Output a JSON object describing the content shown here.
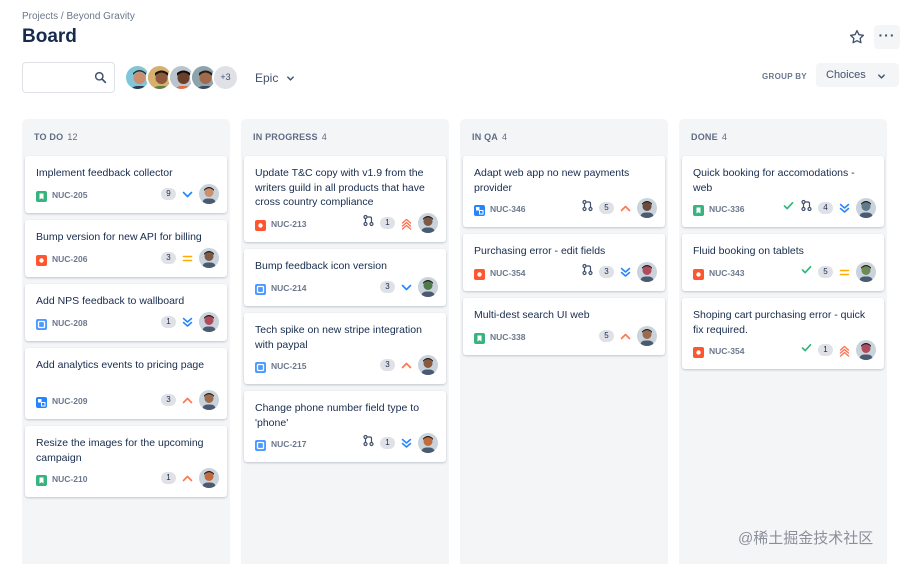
{
  "header": {
    "breadcrumb": "Projects / Beyond Gravity",
    "title": "Board"
  },
  "toolbar": {
    "search_placeholder": "",
    "avatar_more": "+3",
    "epic_label": "Epic",
    "group_by_label": "GROUP BY",
    "group_by_value": "Choices"
  },
  "columns": [
    {
      "name": "TO DO",
      "count": "12",
      "cards": [
        {
          "title": "Implement feedback collector",
          "key": "NUC-205",
          "type": "story",
          "estimate": "9",
          "priority": "low"
        },
        {
          "title": "Bump version for new API for billing",
          "key": "NUC-206",
          "type": "bug",
          "estimate": "3",
          "priority": "medium"
        },
        {
          "title": "Add NPS feedback to wallboard",
          "key": "NUC-208",
          "type": "task",
          "estimate": "1",
          "priority": "lowest"
        },
        {
          "title": "Add analytics events to pricing page",
          "key": "NUC-209",
          "type": "subtask",
          "estimate": "3",
          "priority": "high"
        },
        {
          "title": "Resize the images for the upcoming campaign",
          "key": "NUC-210",
          "type": "story",
          "estimate": "1",
          "priority": "high"
        }
      ]
    },
    {
      "name": "IN PROGRESS",
      "count": "4",
      "cards": [
        {
          "title": "Update T&C copy with v1.9 from the writers guild in all products that have cross country compliance",
          "key": "NUC-213",
          "type": "bug",
          "estimate": "1",
          "priority": "highest",
          "pr": true
        },
        {
          "title": "Bump feedback icon version",
          "key": "NUC-214",
          "type": "task",
          "estimate": "3",
          "priority": "low"
        },
        {
          "title": "Tech spike on new stripe integration with paypal",
          "key": "NUC-215",
          "type": "task",
          "estimate": "3",
          "priority": "high"
        },
        {
          "title": "Change phone number field type to 'phone'",
          "key": "NUC-217",
          "type": "task",
          "estimate": "1",
          "priority": "lowest",
          "pr": true
        }
      ]
    },
    {
      "name": "IN QA",
      "count": "4",
      "cards": [
        {
          "title": "Adapt web app no new payments provider",
          "key": "NUC-346",
          "type": "subtask",
          "estimate": "5",
          "priority": "high",
          "pr": true
        },
        {
          "title": "Purchasing error - edit fields",
          "key": "NUC-354",
          "type": "bug",
          "estimate": "3",
          "priority": "lowest",
          "pr": true
        },
        {
          "title": "Multi-dest search UI web",
          "key": "NUC-338",
          "type": "story",
          "estimate": "5",
          "priority": "high"
        }
      ]
    },
    {
      "name": "DONE",
      "count": "4",
      "cards": [
        {
          "title": "Quick booking for accomodations - web",
          "key": "NUC-336",
          "type": "story",
          "estimate": "4",
          "priority": "lowest",
          "pr": true,
          "done": true
        },
        {
          "title": "Fluid booking on tablets",
          "key": "NUC-343",
          "type": "bug",
          "estimate": "5",
          "priority": "medium",
          "done": true
        },
        {
          "title": "Shoping cart purchasing error - quick fix required.",
          "key": "NUC-354",
          "type": "bug",
          "estimate": "1",
          "priority": "highest",
          "done": true
        }
      ]
    }
  ],
  "watermark": "@稀土掘金技术社区",
  "colors": {
    "story": "#36b37e",
    "bug": "#ff5630",
    "task": "#4c9aff",
    "subtask": "#2684ff",
    "priority_high": "#ff7452",
    "priority_low": "#2684ff",
    "priority_medium": "#ffab00",
    "done_check": "#36b37e"
  }
}
